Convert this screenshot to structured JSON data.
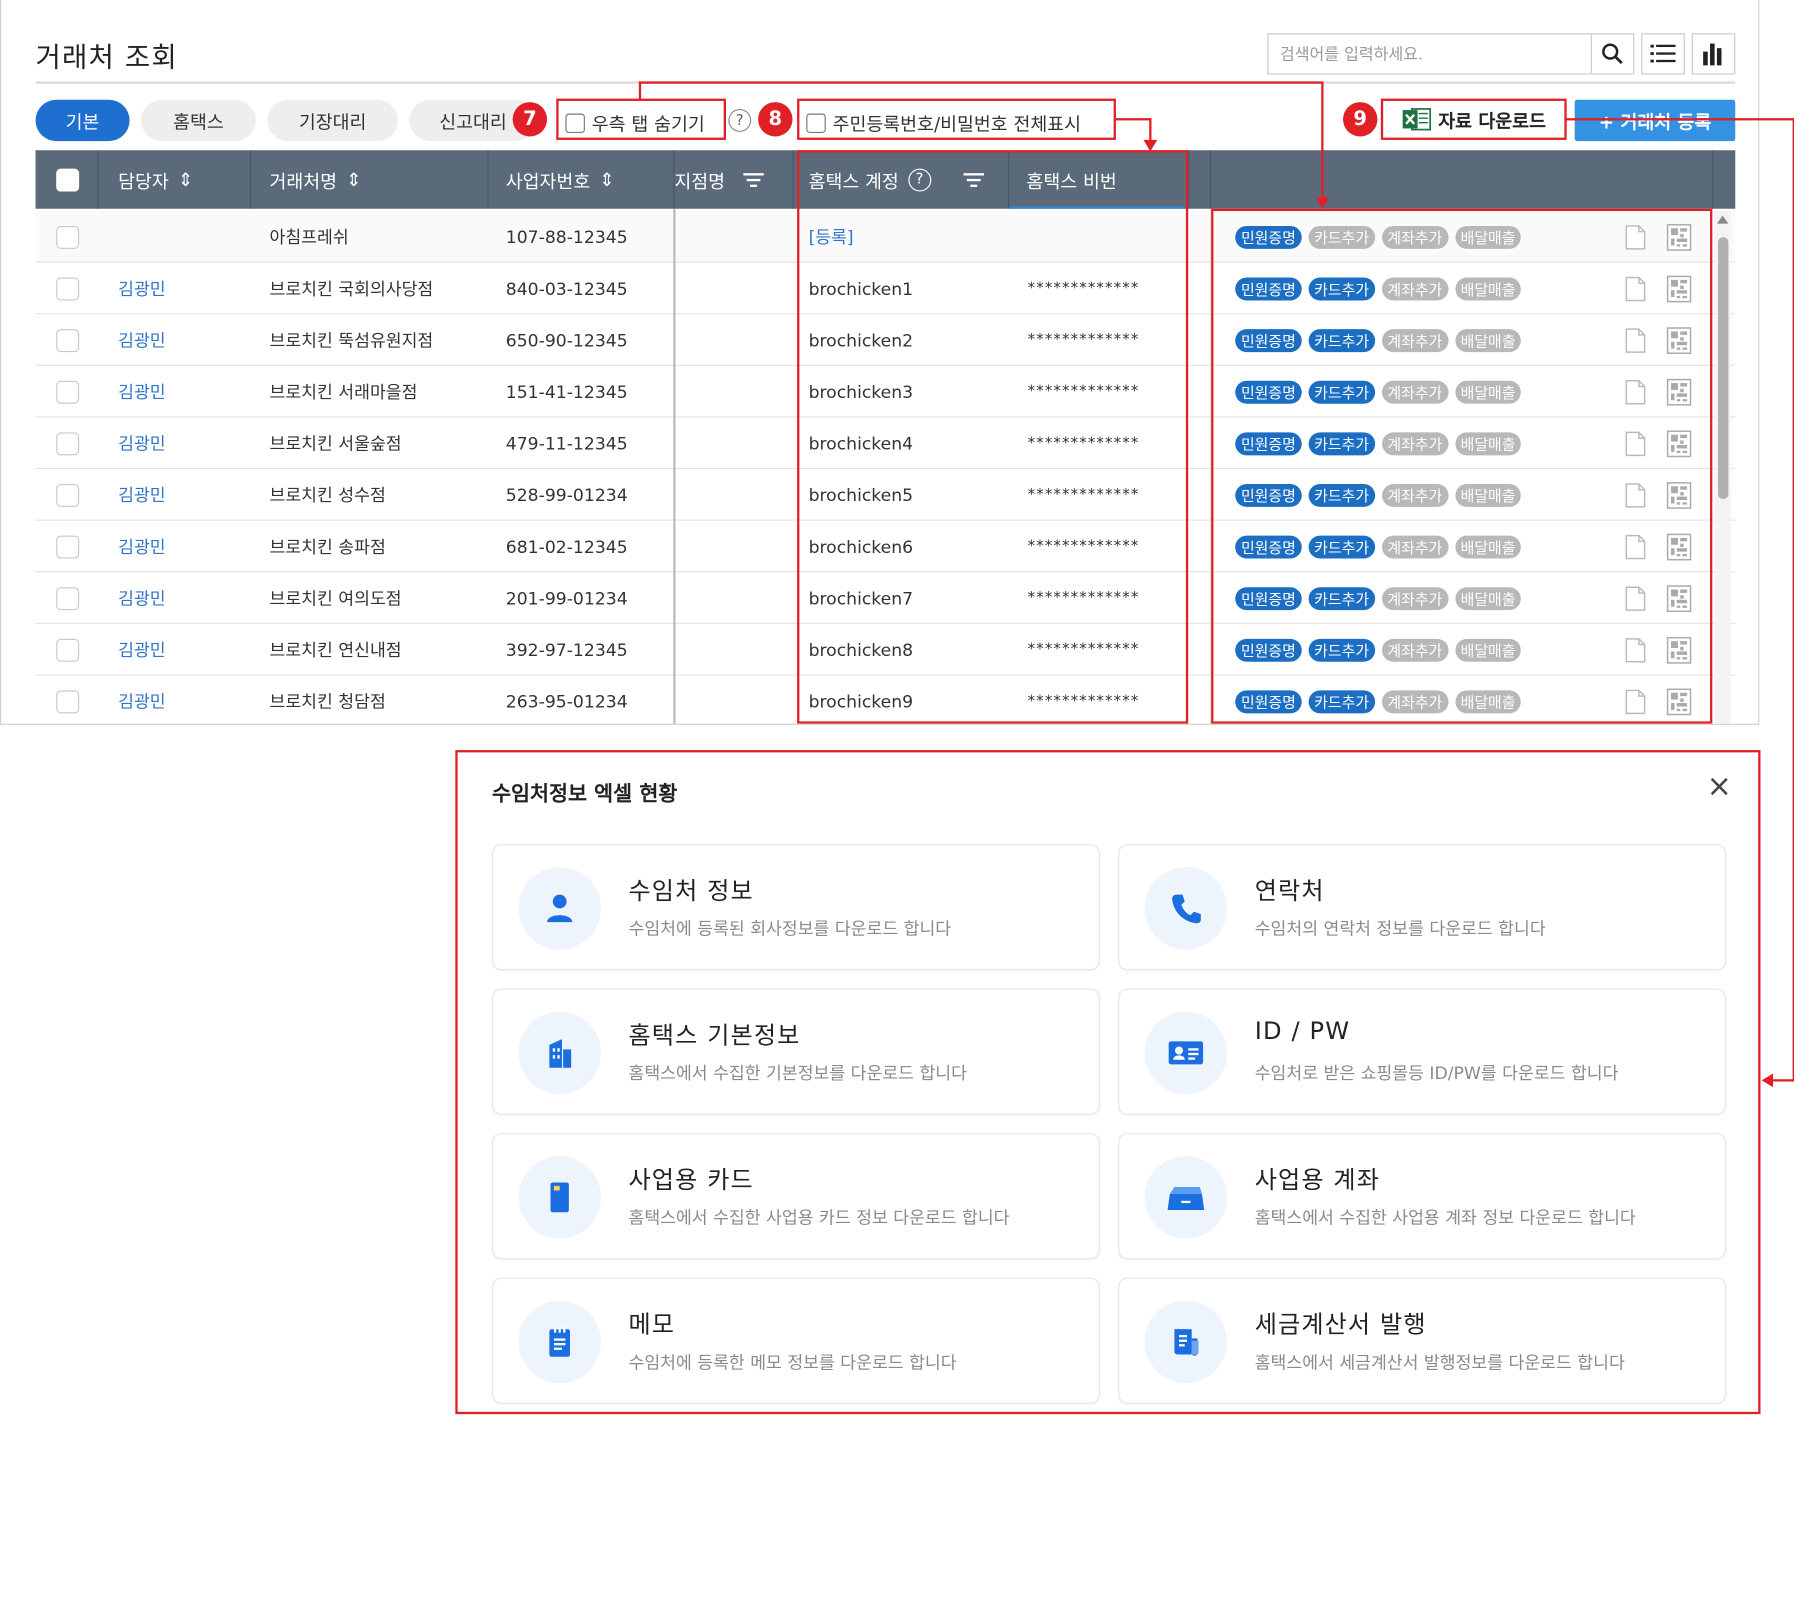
{
  "page": {
    "title": "거래처 조회",
    "search_placeholder": "검색어를 입력하세요."
  },
  "tabs": [
    "기본",
    "홈택스",
    "기장대리",
    "신고대리"
  ],
  "controls": {
    "hide_right_tab": "우측 탭 숨기기",
    "show_full_id": "주민등록번호/비밀번호 전체표시",
    "download": "자료 다운로드",
    "register": "+ 거래처 등록",
    "help": "?"
  },
  "callouts": [
    "7",
    "8",
    "9"
  ],
  "columns": {
    "manager": "담당자",
    "client_name": "거래처명",
    "biz_no": "사업자번호",
    "branch": "지점명",
    "hometax_account": "홈택스 계정",
    "hometax_pw": "홈택스 비번"
  },
  "rows": [
    {
      "manager": "",
      "name": "아침프레쉬",
      "biz_no": "107-88-12345",
      "account": "[등록]",
      "pw": "",
      "card_on": false
    },
    {
      "manager": "김광민",
      "name": "브로치킨 국회의사당점",
      "biz_no": "840-03-12345",
      "account": "brochicken1",
      "pw": "*************",
      "card_on": true
    },
    {
      "manager": "김광민",
      "name": "브로치킨 뚝섬유원지점",
      "biz_no": "650-90-12345",
      "account": "brochicken2",
      "pw": "*************",
      "card_on": true
    },
    {
      "manager": "김광민",
      "name": "브로치킨 서래마을점",
      "biz_no": "151-41-12345",
      "account": "brochicken3",
      "pw": "*************",
      "card_on": true
    },
    {
      "manager": "김광민",
      "name": "브로치킨 서울숲점",
      "biz_no": "479-11-12345",
      "account": "brochicken4",
      "pw": "*************",
      "card_on": true
    },
    {
      "manager": "김광민",
      "name": "브로치킨 성수점",
      "biz_no": "528-99-01234",
      "account": "brochicken5",
      "pw": "*************",
      "card_on": true
    },
    {
      "manager": "김광민",
      "name": "브로치킨 송파점",
      "biz_no": "681-02-12345",
      "account": "brochicken6",
      "pw": "*************",
      "card_on": true
    },
    {
      "manager": "김광민",
      "name": "브로치킨 여의도점",
      "biz_no": "201-99-01234",
      "account": "brochicken7",
      "pw": "*************",
      "card_on": true
    },
    {
      "manager": "김광민",
      "name": "브로치킨 연신내점",
      "biz_no": "392-97-12345",
      "account": "brochicken8",
      "pw": "*************",
      "card_on": true
    },
    {
      "manager": "김광민",
      "name": "브로치킨 청담점",
      "biz_no": "263-95-01234",
      "account": "brochicken9",
      "pw": "*************",
      "card_on": true
    }
  ],
  "row_tags": [
    "민원증명",
    "카드추가",
    "계좌추가",
    "배달매출"
  ],
  "modal": {
    "title": "수임처정보 엑셀 현황",
    "close": "×",
    "cards": [
      {
        "title": "수임처 정보",
        "desc": "수임처에 등록된 회사정보를 다운로드 합니다",
        "icon": "person-icon"
      },
      {
        "title": "연락처",
        "desc": "수임처의 연락처 정보를 다운로드 합니다",
        "icon": "phone-icon"
      },
      {
        "title": "홈택스 기본정보",
        "desc": "홈택스에서 수집한 기본정보를 다운로드 합니다",
        "icon": "building-icon"
      },
      {
        "title": "ID / PW",
        "desc": "수임처로 받은 쇼핑몰등 ID/PW를 다운로드 합니다",
        "icon": "id-card-icon"
      },
      {
        "title": "사업용 카드",
        "desc": "홈택스에서 수집한 사업용 카드 정보 다운로드 합니다",
        "icon": "card-icon"
      },
      {
        "title": "사업용 계좌",
        "desc": "홈택스에서 수집한 사업용 계좌 정보 다운로드 합니다",
        "icon": "bank-icon"
      },
      {
        "title": "메모",
        "desc": "수임처에 등록한 메모 정보를 다운로드 합니다",
        "icon": "memo-icon"
      },
      {
        "title": "세금계산서 발행",
        "desc": "홈택스에서 세금계산서 발행정보를 다운로드 합니다",
        "icon": "receipt-icon"
      }
    ]
  },
  "colors": {
    "accent": "#1e6fd0",
    "header": "#5b6a7b",
    "highlight": "#e01f26",
    "tag_active": "#1b6ec2",
    "tag_inactive": "#b8b8b8"
  }
}
